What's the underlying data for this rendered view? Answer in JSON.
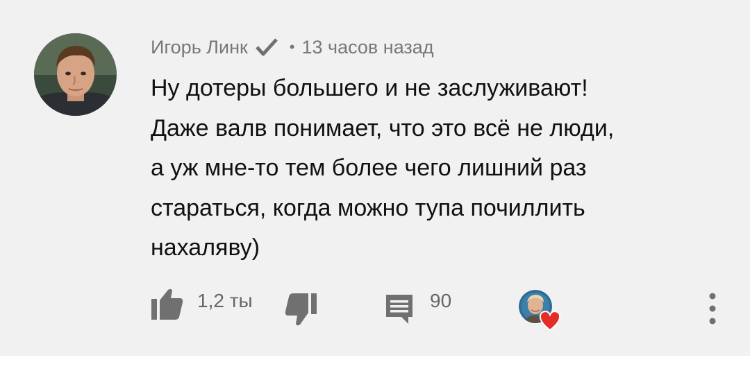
{
  "comment": {
    "author": "Игорь Линк",
    "separator": "•",
    "time": "13 часов назад",
    "text": "Ну дотеры большего и не заслуживают!\nДаже валв понимает, что это всё не люди,\nа уж мне-то тем более чего лишний раз\nстараться, когда можно тупа почиллить\nнахаляву)",
    "icons": {
      "avatar": "user-avatar",
      "verified": "check-icon"
    }
  },
  "actions": {
    "like_count": "1,2 ты",
    "reply_count": "90",
    "icons": {
      "like": "thumbs-up-icon",
      "dislike": "thumbs-down-icon",
      "reply": "comment-icon",
      "creator_heart": "heart-icon",
      "more": "more-vertical-icon"
    }
  },
  "colors": {
    "card_background": "#f1f1f1",
    "text": "#111111",
    "meta_text": "#777777",
    "icon": "#707070",
    "heart": "#e52d27"
  }
}
